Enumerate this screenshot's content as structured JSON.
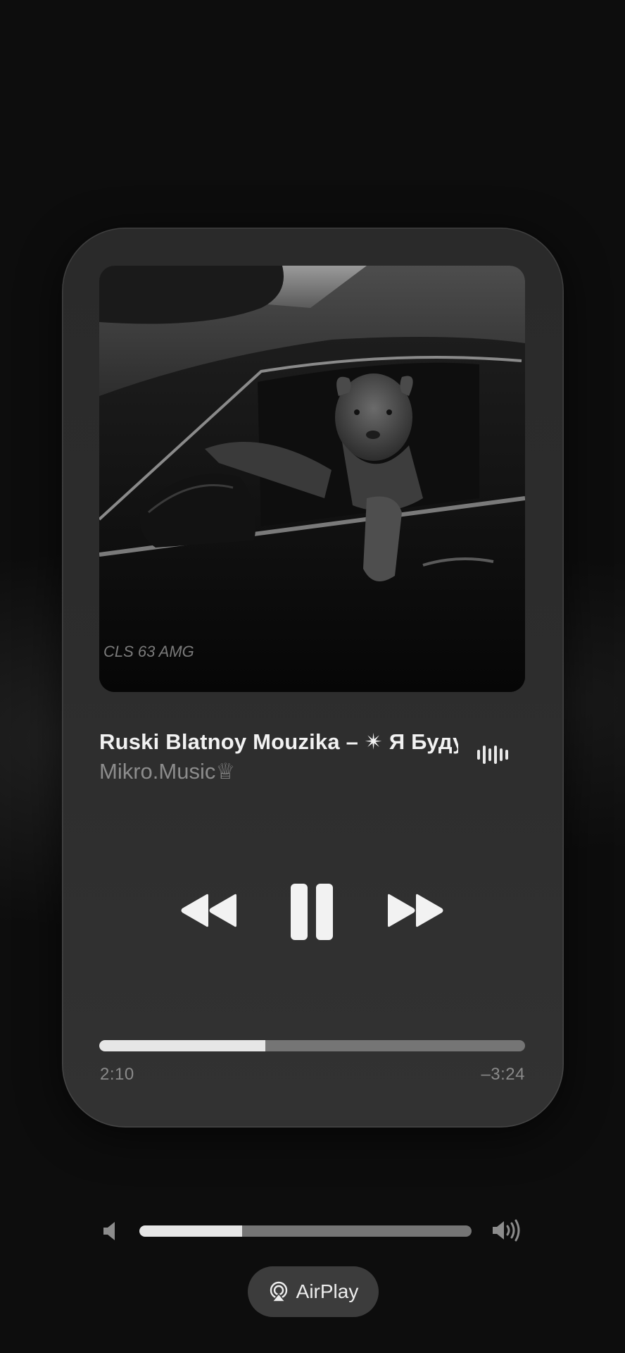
{
  "now_playing": {
    "title": "Ruski Blatnoy Mouzika – ✴ Я Буду",
    "artist": "Mikro.Music♕",
    "artwork_icon": "album-artwork-lion-in-car",
    "artwork_text": "CLS 63 AMG"
  },
  "playback": {
    "elapsed": "2:10",
    "remaining": "–3:24",
    "progress_fraction": 0.39
  },
  "controls": {
    "rewind_icon": "backward-icon",
    "play_pause_icon": "pause-icon",
    "forward_icon": "forward-icon"
  },
  "volume": {
    "level_fraction": 0.31,
    "low_icon": "speaker-low-icon",
    "high_icon": "speaker-high-icon"
  },
  "airplay": {
    "label": "AirPlay",
    "icon": "airplay-icon"
  },
  "colors": {
    "background": "#0d0d0d",
    "card": "#2d2d2d",
    "track": "#757575",
    "fill": "#e6e6e6",
    "secondary_text": "#8c8c8c"
  }
}
